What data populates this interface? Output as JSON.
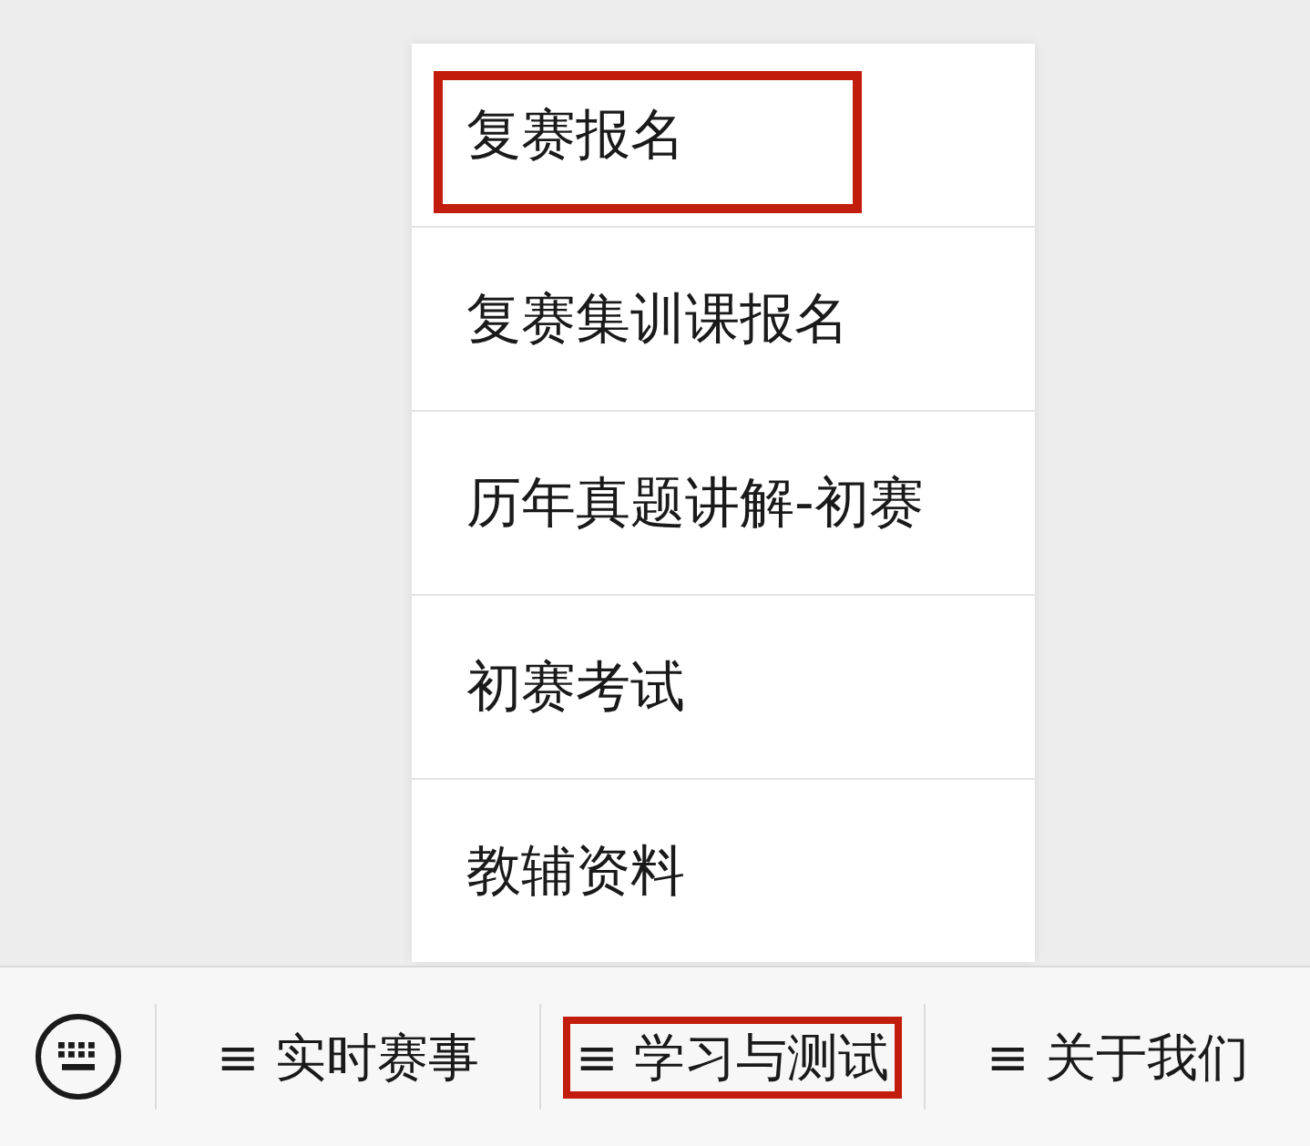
{
  "menu": {
    "items": [
      {
        "label": "复赛报名",
        "highlighted": true
      },
      {
        "label": "复赛集训课报名",
        "highlighted": false
      },
      {
        "label": "历年真题讲解-初赛",
        "highlighted": false
      },
      {
        "label": "初赛考试",
        "highlighted": false
      },
      {
        "label": "教辅资料",
        "highlighted": false
      }
    ]
  },
  "bottom_bar": {
    "tabs": [
      {
        "label": "≡ 实时赛事",
        "highlighted": false
      },
      {
        "label": "≡ 学习与测试",
        "highlighted": true
      },
      {
        "label": "≡ 关于我们",
        "highlighted": false
      }
    ]
  }
}
